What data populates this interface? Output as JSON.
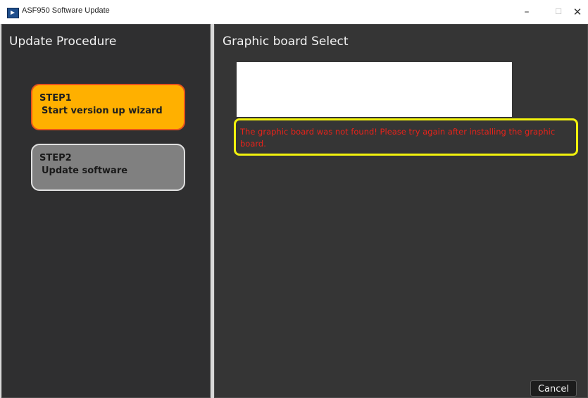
{
  "window": {
    "title": "ASF950 Software Update",
    "minimize_glyph": "–",
    "maximize_glyph": "☐",
    "close_glyph": "✕"
  },
  "sidebar": {
    "heading": "Update Procedure",
    "steps": [
      {
        "label": "STEP1",
        "description": "Start version up wizard",
        "state": "active",
        "color": "#ffb000"
      },
      {
        "label": "STEP2",
        "description": "Update software",
        "state": "inactive",
        "color": "#808080"
      }
    ]
  },
  "main": {
    "heading": "Graphic board Select",
    "board_list_items": [],
    "error_message": "The graphic board was not found! Please try again after installing the graphic board.",
    "error_color": "#e8231a",
    "highlight_color": "#f2f20d"
  },
  "footer": {
    "cancel_label": "Cancel"
  },
  "icons": {
    "app": "app-icon"
  }
}
